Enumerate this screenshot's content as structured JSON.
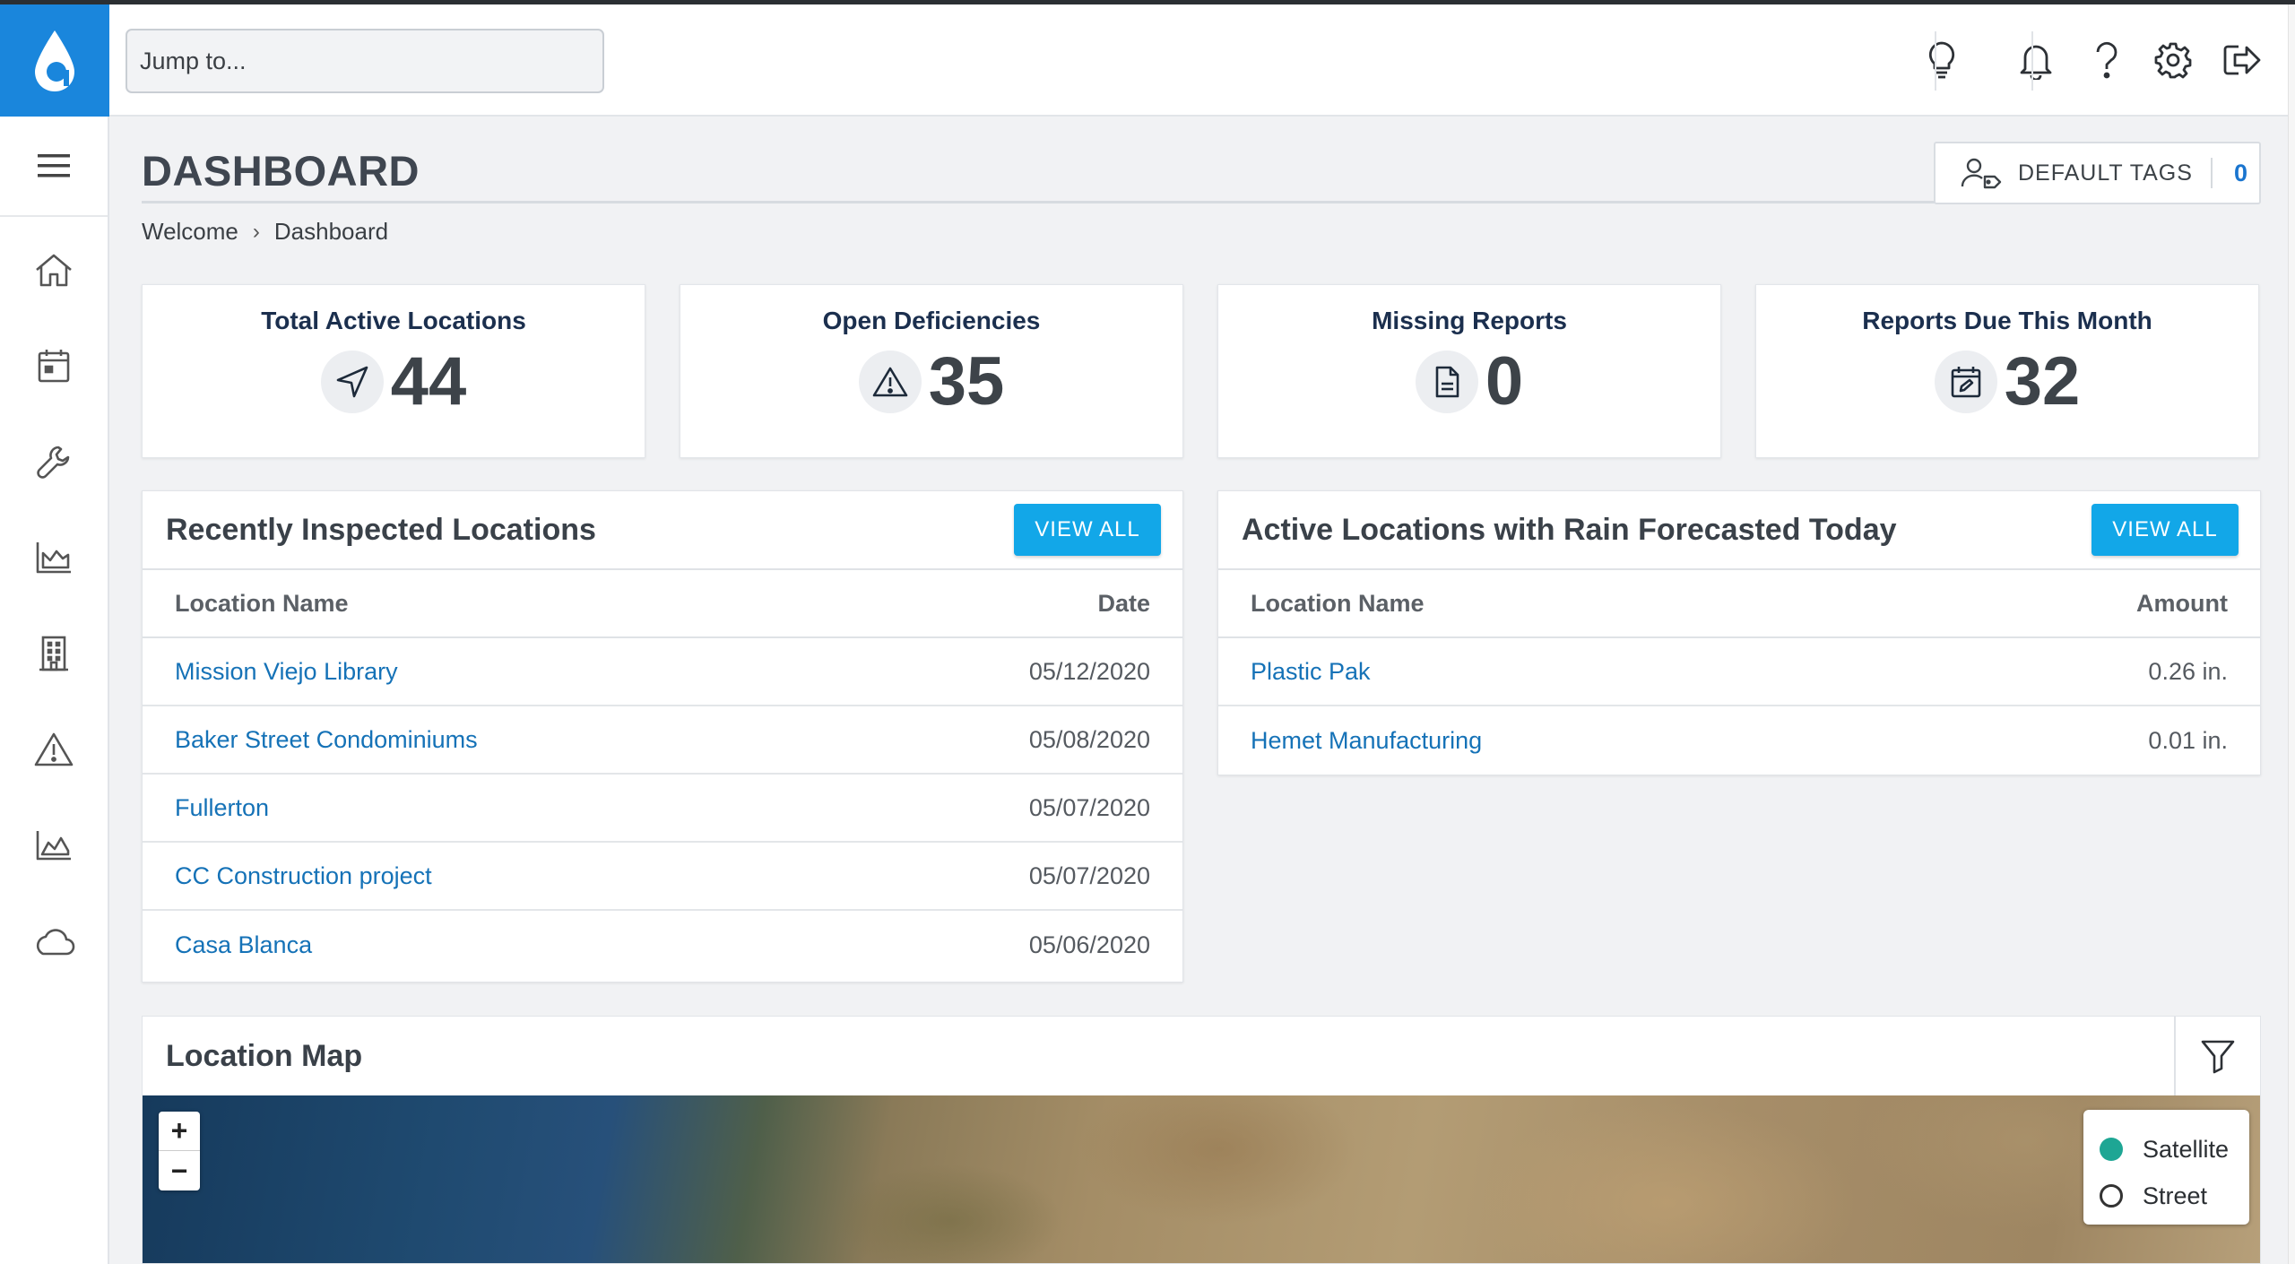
{
  "header": {
    "search_placeholder": "Jump to..."
  },
  "page": {
    "title": "DASHBOARD",
    "default_tags_label": "DEFAULT TAGS",
    "default_tags_count": "0"
  },
  "breadcrumb": [
    "Welcome",
    "Dashboard"
  ],
  "sidebar": {
    "items": [
      "home-icon",
      "calendar-icon",
      "wrench-icon",
      "industry-chart-icon",
      "building-icon",
      "warning-icon",
      "area-chart-icon",
      "cloud-icon"
    ]
  },
  "stats": [
    {
      "label": "Total Active Locations",
      "value": "44",
      "icon": "navigation-arrow-icon"
    },
    {
      "label": "Open Deficiencies",
      "value": "35",
      "icon": "warning-icon"
    },
    {
      "label": "Missing Reports",
      "value": "0",
      "icon": "document-icon"
    },
    {
      "label": "Reports Due This Month",
      "value": "32",
      "icon": "calendar-edit-icon"
    }
  ],
  "inspected": {
    "title": "Recently Inspected Locations",
    "view_all": "VIEW ALL",
    "col_name": "Location Name",
    "col_date": "Date",
    "rows": [
      {
        "name": "Mission Viejo Library",
        "date": "05/12/2020"
      },
      {
        "name": "Baker Street Condominiums",
        "date": "05/08/2020"
      },
      {
        "name": "Fullerton",
        "date": "05/07/2020"
      },
      {
        "name": "CC Construction project",
        "date": "05/07/2020"
      },
      {
        "name": "Casa Blanca",
        "date": "05/06/2020"
      }
    ]
  },
  "rain": {
    "title": "Active Locations with Rain Forecasted Today",
    "view_all": "VIEW ALL",
    "col_name": "Location Name",
    "col_amount": "Amount",
    "rows": [
      {
        "name": "Plastic Pak",
        "amount": "0.26 in."
      },
      {
        "name": "Hemet Manufacturing",
        "amount": "0.01 in."
      }
    ]
  },
  "map": {
    "title": "Location Map",
    "zoom_in": "+",
    "zoom_out": "−",
    "layers": [
      "Satellite",
      "Street"
    ],
    "selected_layer": "Satellite"
  },
  "colors": {
    "brand": "#1a86dc",
    "accent": "#12a7e8",
    "link": "#1572b7"
  }
}
